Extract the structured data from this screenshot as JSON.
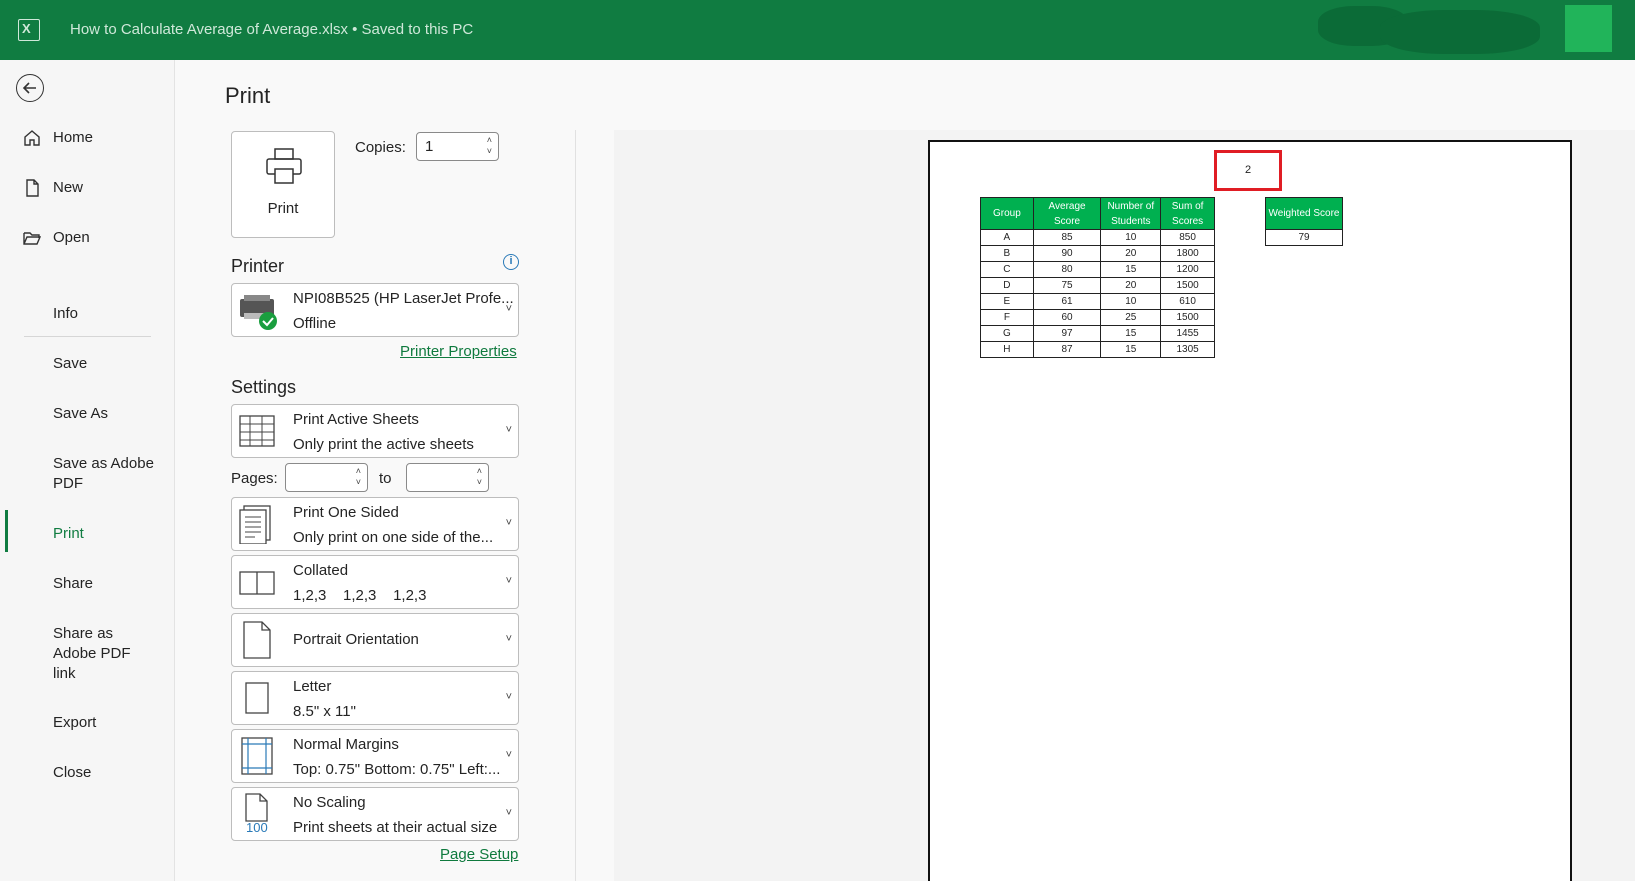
{
  "window": {
    "title": "How to Calculate Average of Average.xlsx  •  Saved to this PC",
    "brand_color": "#107c41"
  },
  "sidebar": {
    "items": [
      {
        "label": "Home",
        "icon": "home-icon"
      },
      {
        "label": "New",
        "icon": "new-document-icon"
      },
      {
        "label": "Open",
        "icon": "folder-open-icon"
      },
      {
        "label": "Info"
      },
      {
        "label": "Save"
      },
      {
        "label": "Save As"
      },
      {
        "label": "Save as Adobe PDF"
      },
      {
        "label": "Print",
        "active": true
      },
      {
        "label": "Share"
      },
      {
        "label": "Share as Adobe PDF link"
      },
      {
        "label": "Export"
      },
      {
        "label": "Close"
      }
    ]
  },
  "print": {
    "heading": "Print",
    "button_label": "Print",
    "copies_label": "Copies:",
    "copies_value": "1",
    "printer_section": "Printer",
    "printer_name": "NPI08B525 (HP LaserJet Profe...",
    "printer_status": "Offline",
    "printer_properties_link": "Printer Properties",
    "settings_section": "Settings",
    "pages_label": "Pages:",
    "to_label": "to",
    "pages_from": "",
    "pages_to": "",
    "settings": [
      {
        "line1": "Print Active Sheets",
        "line2": "Only print the active sheets",
        "icon": "sheet-grid-icon"
      },
      {
        "line1": "Print One Sided",
        "line2": "Only print on one side of the...",
        "icon": "one-sided-icon"
      },
      {
        "line1": "Collated",
        "line2": "1,2,3    1,2,3    1,2,3",
        "icon": "collated-icon"
      },
      {
        "line1": "Portrait Orientation",
        "line2": "",
        "icon": "portrait-icon"
      },
      {
        "line1": "Letter",
        "line2": "8.5\" x 11\"",
        "icon": "paper-size-icon"
      },
      {
        "line1": "Normal Margins",
        "line2": "Top: 0.75\" Bottom: 0.75\" Left:...",
        "icon": "margins-icon"
      },
      {
        "line1": "No Scaling",
        "line2": "Print sheets at their actual size",
        "icon": "scaling-icon",
        "scale_text": "100"
      }
    ],
    "page_setup_link": "Page Setup"
  },
  "preview": {
    "highlight_value": "2",
    "table_headers": [
      [
        "Group"
      ],
      [
        "Average",
        "Score"
      ],
      [
        "Number of",
        "Students"
      ],
      [
        "Sum of",
        "Scores"
      ]
    ],
    "rows": [
      [
        "A",
        "85",
        "10",
        "850"
      ],
      [
        "B",
        "90",
        "20",
        "1800"
      ],
      [
        "C",
        "80",
        "15",
        "1200"
      ],
      [
        "D",
        "75",
        "20",
        "1500"
      ],
      [
        "E",
        "61",
        "10",
        "610"
      ],
      [
        "F",
        "60",
        "25",
        "1500"
      ],
      [
        "G",
        "97",
        "15",
        "1455"
      ],
      [
        "H",
        "87",
        "15",
        "1305"
      ]
    ],
    "weighted_header": "Weighted Score",
    "weighted_value": "79",
    "header_color": "#00b050",
    "highlight_color": "#e01d24"
  }
}
